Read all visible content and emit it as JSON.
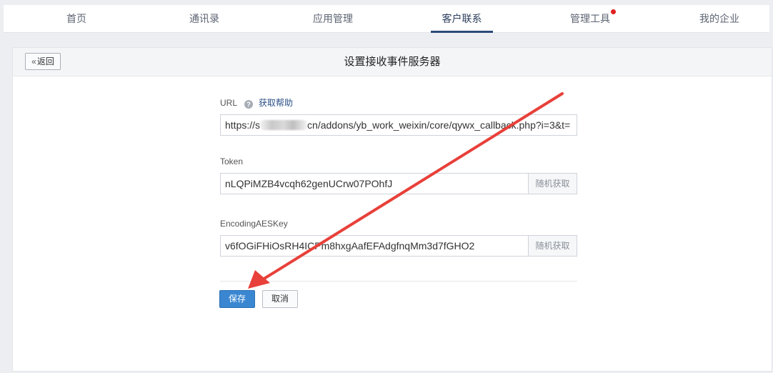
{
  "nav": {
    "items": [
      {
        "label": "首页"
      },
      {
        "label": "通讯录"
      },
      {
        "label": "应用管理"
      },
      {
        "label": "客户联系"
      },
      {
        "label": "管理工具"
      },
      {
        "label": "我的企业"
      }
    ],
    "active_index": 3
  },
  "panel": {
    "back_label": "返回",
    "title": "设置接收事件服务器"
  },
  "form": {
    "url": {
      "label": "URL",
      "help_link": "获取帮助",
      "value_prefix": "https://s",
      "value_suffix": "cn/addons/yb_work_weixin/core/qywx_callback.php?i=3&t="
    },
    "token": {
      "label": "Token",
      "value": "nLQPiMZB4vcqh62genUCrw07POhfJ",
      "random_label": "随机获取"
    },
    "aes": {
      "label": "EncodingAESKey",
      "value": "v6fOGiFHiOsRH4ICPm8hxgAafEFAdgfnqMm3d7fGHO2",
      "random_label": "随机获取"
    },
    "save_label": "保存",
    "cancel_label": "取消"
  },
  "colors": {
    "primary": "#3a86d1",
    "annotation_arrow": "#e8403a",
    "notification_dot": "#e02020"
  },
  "icons": {
    "help": "question-circle-icon",
    "back": "double-chevron-left-icon"
  }
}
